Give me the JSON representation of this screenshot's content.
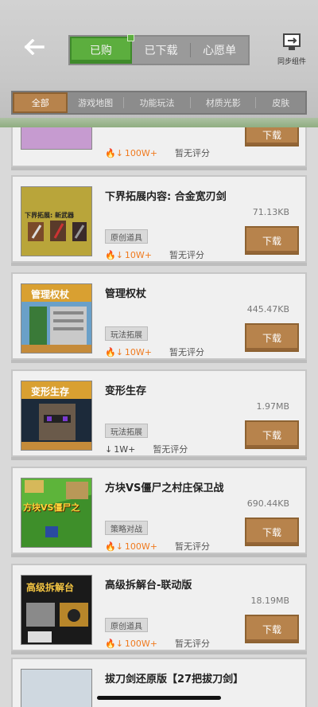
{
  "header": {
    "tabs": [
      {
        "label": "已购",
        "active": true
      },
      {
        "label": "已下载",
        "active": false
      },
      {
        "label": "心愿单",
        "active": false
      }
    ],
    "sync_label": "同步组件",
    "back_icon": "arrow-left-icon",
    "sync_icon": "monitor-sync-icon"
  },
  "categories": [
    "全部",
    "游戏地图",
    "功能玩法",
    "材质光影",
    "皮肤"
  ],
  "partial_top": {
    "downloads": "100W+",
    "rating": "暂无评分",
    "button": "下载"
  },
  "items": [
    {
      "title": "下界拓展内容: 合金宽刃剑",
      "size": "71.13KB",
      "tag": "原创道具",
      "downloads": "10W+",
      "hot": true,
      "rating": "暂无评分",
      "button": "下载",
      "thumb_text": "下界拓展: 新武器"
    },
    {
      "title": "管理权杖",
      "size": "445.47KB",
      "tag": "玩法拓展",
      "downloads": "10W+",
      "hot": true,
      "rating": "暂无评分",
      "button": "下载",
      "thumb_text": "管理权杖"
    },
    {
      "title": "变形生存",
      "size": "1.97MB",
      "tag": "玩法拓展",
      "downloads": "1W+",
      "hot": false,
      "rating": "暂无评分",
      "button": "下载",
      "thumb_text": "变形生存"
    },
    {
      "title": "方块VS僵尸之村庄保卫战",
      "size": "690.44KB",
      "tag": "策略对战",
      "downloads": "100W+",
      "hot": true,
      "rating": "暂无评分",
      "button": "下载",
      "thumb_text": "方块VS僵尸之"
    },
    {
      "title": "高级拆解台-联动版",
      "size": "18.19MB",
      "tag": "原创道具",
      "downloads": "100W+",
      "hot": true,
      "rating": "暂无评分",
      "button": "下载",
      "thumb_text": "高级拆解台"
    }
  ],
  "partial_bottom": {
    "title": "拔刀剑还原版【27把拔刀剑】"
  },
  "colors": {
    "accent_green": "#5cae3e",
    "button_brown": "#b7834c",
    "hot_orange": "#f07a1e"
  }
}
